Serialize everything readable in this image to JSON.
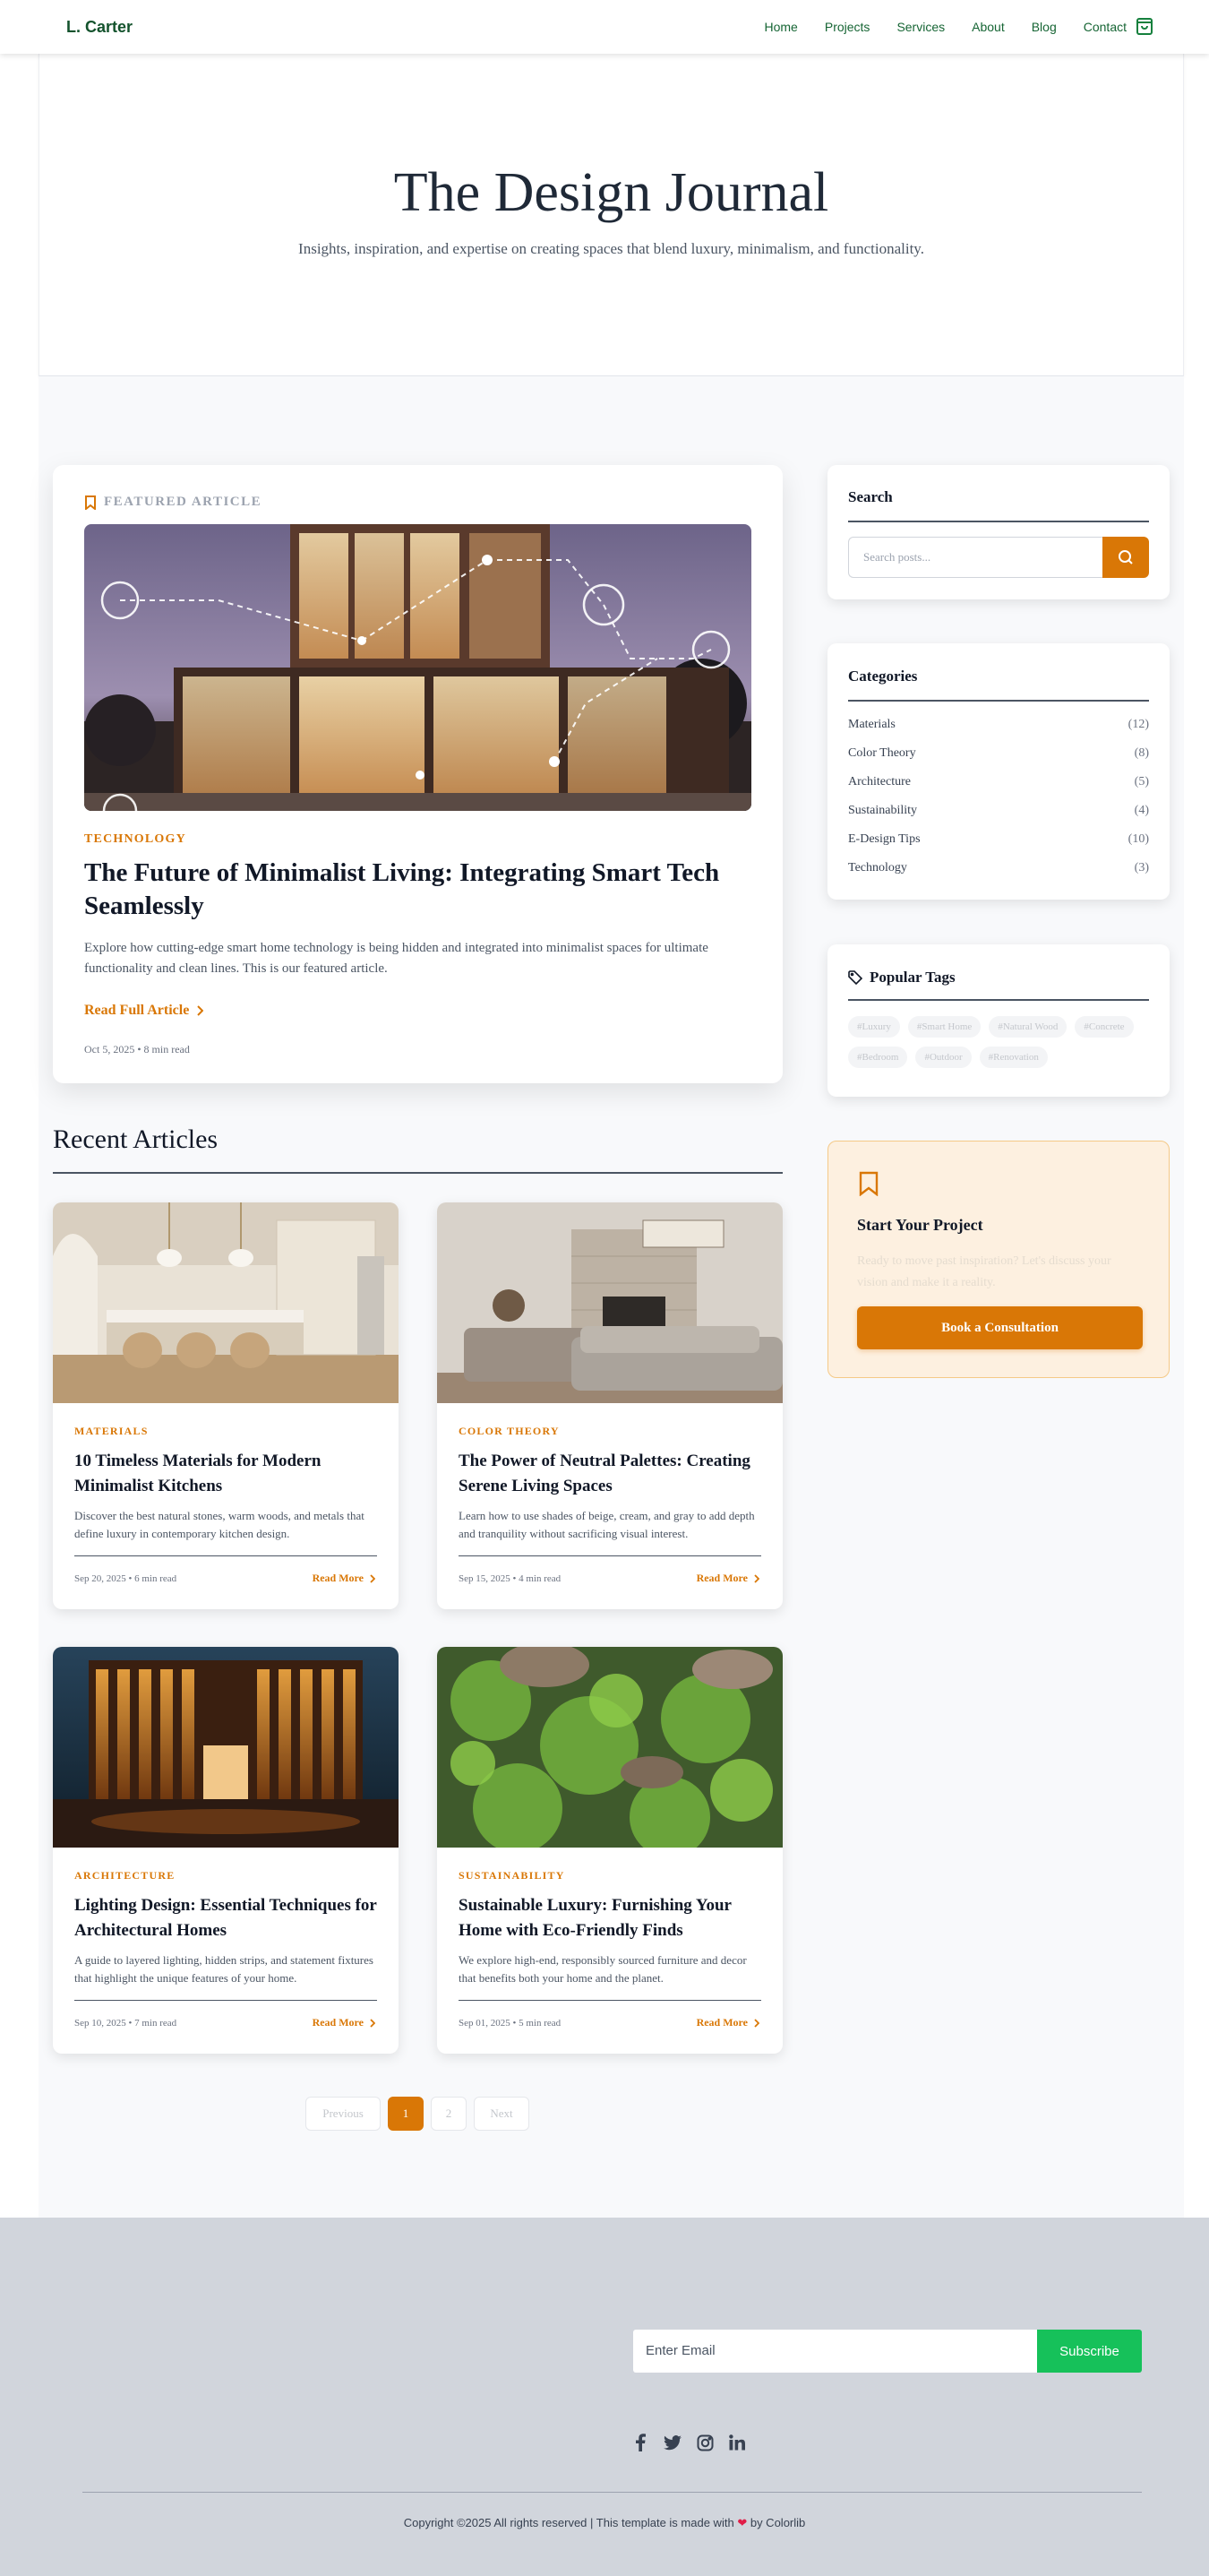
{
  "nav": {
    "brand": "L. Carter",
    "links": [
      "Home",
      "Projects",
      "Services",
      "About",
      "Blog",
      "Contact"
    ],
    "cart_icon": "shopping-bag-icon"
  },
  "hero": {
    "title": "The Design Journal",
    "subtitle": "Insights, inspiration, and expertise on creating spaces that blend luxury, minimalism, and functionality."
  },
  "featured": {
    "label": "FEATURED ARTICLE",
    "category": "TECHNOLOGY",
    "title": "The Future of Minimalist Living: Integrating Smart Tech Seamlessly",
    "excerpt": "Explore how cutting-edge smart home technology is being hidden and integrated into minimalist spaces for ultimate functionality and clean lines. This is our featured article.",
    "read_more": "Read Full Article",
    "meta": "Oct 5, 2025 • 8 min read"
  },
  "recent": {
    "heading": "Recent Articles",
    "articles": [
      {
        "category": "MATERIALS",
        "title": "10 Timeless Materials for Modern Minimalist Kitchens",
        "excerpt": "Discover the best natural stones, warm woods, and metals that define luxury in contemporary kitchen design.",
        "meta": "Sep 20, 2025 • 6 min read",
        "more": "Read More"
      },
      {
        "category": "COLOR THEORY",
        "title": "The Power of Neutral Palettes: Creating Serene Living Spaces",
        "excerpt": "Learn how to use shades of beige, cream, and gray to add depth and tranquility without sacrificing visual interest.",
        "meta": "Sep 15, 2025 • 4 min read",
        "more": "Read More"
      },
      {
        "category": "ARCHITECTURE",
        "title": "Lighting Design: Essential Techniques for Architectural Homes",
        "excerpt": "A guide to layered lighting, hidden strips, and statement fixtures that highlight the unique features of your home.",
        "meta": "Sep 10, 2025 • 7 min read",
        "more": "Read More"
      },
      {
        "category": "SUSTAINABILITY",
        "title": "Sustainable Luxury: Furnishing Your Home with Eco-Friendly Finds",
        "excerpt": "We explore high-end, responsibly sourced furniture and decor that benefits both your home and the planet.",
        "meta": "Sep 01, 2025 • 5 min read",
        "more": "Read More"
      }
    ]
  },
  "pagination": {
    "previous": "Previous",
    "pages": [
      "1",
      "2"
    ],
    "current": "1",
    "next": "Next"
  },
  "sidebar": {
    "search": {
      "title": "Search",
      "placeholder": "Search posts..."
    },
    "categories": {
      "title": "Categories",
      "items": [
        {
          "name": "Materials",
          "count": "(12)"
        },
        {
          "name": "Color Theory",
          "count": "(8)"
        },
        {
          "name": "Architecture",
          "count": "(5)"
        },
        {
          "name": "Sustainability",
          "count": "(4)"
        },
        {
          "name": "E-Design Tips",
          "count": "(10)"
        },
        {
          "name": "Technology",
          "count": "(3)"
        }
      ]
    },
    "tags": {
      "title": "Popular Tags",
      "items": [
        "#Luxury",
        "#Smart Home",
        "#Natural Wood",
        "#Concrete",
        "#Bedroom",
        "#Outdoor",
        "#Renovation"
      ]
    },
    "cta": {
      "title": "Start Your Project",
      "text": "Ready to move past inspiration? Let's discuss your vision and make it a reality.",
      "button": "Book a Consultation"
    }
  },
  "footer": {
    "email_placeholder": "Enter Email",
    "subscribe": "Subscribe",
    "socials": [
      "facebook-icon",
      "twitter-icon",
      "instagram-icon",
      "linkedin-icon"
    ],
    "copyright_prefix": "Copyright ©2025 All rights reserved | This template is made with",
    "copyright_suffix": "by Colorlib"
  },
  "colors": {
    "accent": "#d97706",
    "brand": "#166534",
    "subscribe": "#16c15a",
    "footer_bg": "#d1d5dc"
  }
}
